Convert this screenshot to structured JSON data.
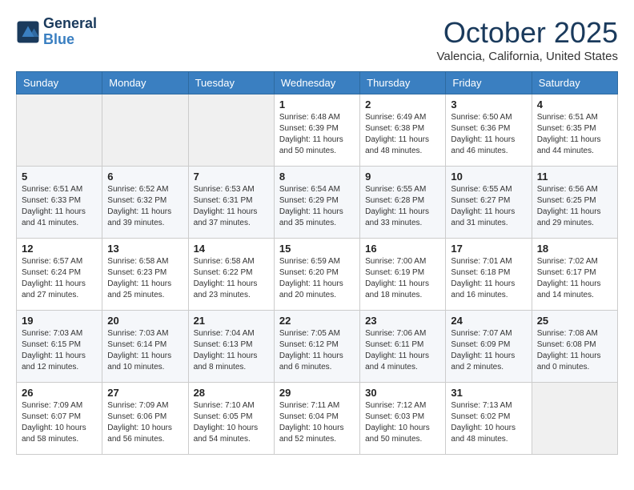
{
  "header": {
    "logo_line1": "General",
    "logo_line2": "Blue",
    "month": "October 2025",
    "location": "Valencia, California, United States"
  },
  "weekdays": [
    "Sunday",
    "Monday",
    "Tuesday",
    "Wednesday",
    "Thursday",
    "Friday",
    "Saturday"
  ],
  "weeks": [
    [
      {
        "day": "",
        "info": ""
      },
      {
        "day": "",
        "info": ""
      },
      {
        "day": "",
        "info": ""
      },
      {
        "day": "1",
        "info": "Sunrise: 6:48 AM\nSunset: 6:39 PM\nDaylight: 11 hours\nand 50 minutes."
      },
      {
        "day": "2",
        "info": "Sunrise: 6:49 AM\nSunset: 6:38 PM\nDaylight: 11 hours\nand 48 minutes."
      },
      {
        "day": "3",
        "info": "Sunrise: 6:50 AM\nSunset: 6:36 PM\nDaylight: 11 hours\nand 46 minutes."
      },
      {
        "day": "4",
        "info": "Sunrise: 6:51 AM\nSunset: 6:35 PM\nDaylight: 11 hours\nand 44 minutes."
      }
    ],
    [
      {
        "day": "5",
        "info": "Sunrise: 6:51 AM\nSunset: 6:33 PM\nDaylight: 11 hours\nand 41 minutes."
      },
      {
        "day": "6",
        "info": "Sunrise: 6:52 AM\nSunset: 6:32 PM\nDaylight: 11 hours\nand 39 minutes."
      },
      {
        "day": "7",
        "info": "Sunrise: 6:53 AM\nSunset: 6:31 PM\nDaylight: 11 hours\nand 37 minutes."
      },
      {
        "day": "8",
        "info": "Sunrise: 6:54 AM\nSunset: 6:29 PM\nDaylight: 11 hours\nand 35 minutes."
      },
      {
        "day": "9",
        "info": "Sunrise: 6:55 AM\nSunset: 6:28 PM\nDaylight: 11 hours\nand 33 minutes."
      },
      {
        "day": "10",
        "info": "Sunrise: 6:55 AM\nSunset: 6:27 PM\nDaylight: 11 hours\nand 31 minutes."
      },
      {
        "day": "11",
        "info": "Sunrise: 6:56 AM\nSunset: 6:25 PM\nDaylight: 11 hours\nand 29 minutes."
      }
    ],
    [
      {
        "day": "12",
        "info": "Sunrise: 6:57 AM\nSunset: 6:24 PM\nDaylight: 11 hours\nand 27 minutes."
      },
      {
        "day": "13",
        "info": "Sunrise: 6:58 AM\nSunset: 6:23 PM\nDaylight: 11 hours\nand 25 minutes."
      },
      {
        "day": "14",
        "info": "Sunrise: 6:58 AM\nSunset: 6:22 PM\nDaylight: 11 hours\nand 23 minutes."
      },
      {
        "day": "15",
        "info": "Sunrise: 6:59 AM\nSunset: 6:20 PM\nDaylight: 11 hours\nand 20 minutes."
      },
      {
        "day": "16",
        "info": "Sunrise: 7:00 AM\nSunset: 6:19 PM\nDaylight: 11 hours\nand 18 minutes."
      },
      {
        "day": "17",
        "info": "Sunrise: 7:01 AM\nSunset: 6:18 PM\nDaylight: 11 hours\nand 16 minutes."
      },
      {
        "day": "18",
        "info": "Sunrise: 7:02 AM\nSunset: 6:17 PM\nDaylight: 11 hours\nand 14 minutes."
      }
    ],
    [
      {
        "day": "19",
        "info": "Sunrise: 7:03 AM\nSunset: 6:15 PM\nDaylight: 11 hours\nand 12 minutes."
      },
      {
        "day": "20",
        "info": "Sunrise: 7:03 AM\nSunset: 6:14 PM\nDaylight: 11 hours\nand 10 minutes."
      },
      {
        "day": "21",
        "info": "Sunrise: 7:04 AM\nSunset: 6:13 PM\nDaylight: 11 hours\nand 8 minutes."
      },
      {
        "day": "22",
        "info": "Sunrise: 7:05 AM\nSunset: 6:12 PM\nDaylight: 11 hours\nand 6 minutes."
      },
      {
        "day": "23",
        "info": "Sunrise: 7:06 AM\nSunset: 6:11 PM\nDaylight: 11 hours\nand 4 minutes."
      },
      {
        "day": "24",
        "info": "Sunrise: 7:07 AM\nSunset: 6:09 PM\nDaylight: 11 hours\nand 2 minutes."
      },
      {
        "day": "25",
        "info": "Sunrise: 7:08 AM\nSunset: 6:08 PM\nDaylight: 11 hours\nand 0 minutes."
      }
    ],
    [
      {
        "day": "26",
        "info": "Sunrise: 7:09 AM\nSunset: 6:07 PM\nDaylight: 10 hours\nand 58 minutes."
      },
      {
        "day": "27",
        "info": "Sunrise: 7:09 AM\nSunset: 6:06 PM\nDaylight: 10 hours\nand 56 minutes."
      },
      {
        "day": "28",
        "info": "Sunrise: 7:10 AM\nSunset: 6:05 PM\nDaylight: 10 hours\nand 54 minutes."
      },
      {
        "day": "29",
        "info": "Sunrise: 7:11 AM\nSunset: 6:04 PM\nDaylight: 10 hours\nand 52 minutes."
      },
      {
        "day": "30",
        "info": "Sunrise: 7:12 AM\nSunset: 6:03 PM\nDaylight: 10 hours\nand 50 minutes."
      },
      {
        "day": "31",
        "info": "Sunrise: 7:13 AM\nSunset: 6:02 PM\nDaylight: 10 hours\nand 48 minutes."
      },
      {
        "day": "",
        "info": ""
      }
    ]
  ]
}
